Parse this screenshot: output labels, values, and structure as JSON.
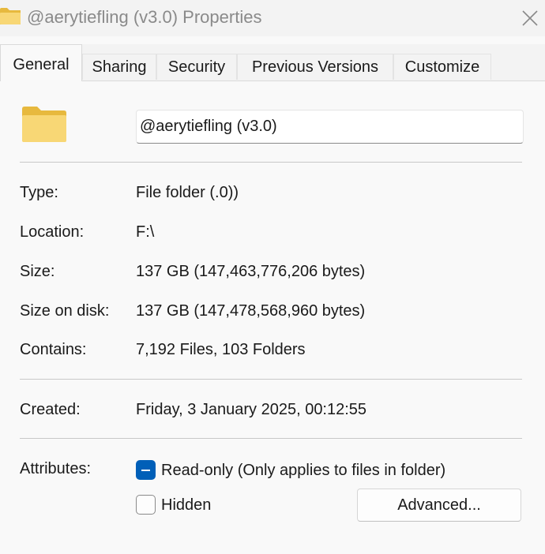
{
  "window": {
    "title": "@aerytiefling (v3.0) Properties",
    "close_icon": "close-icon"
  },
  "tabs": [
    {
      "label": "General",
      "active": true
    },
    {
      "label": "Sharing",
      "active": false
    },
    {
      "label": "Security",
      "active": false
    },
    {
      "label": "Previous Versions",
      "active": false
    },
    {
      "label": "Customize",
      "active": false
    }
  ],
  "general": {
    "folder_icon": "folder-icon",
    "name_value": "@aerytiefling (v3.0)",
    "details": [
      {
        "label": "Type:",
        "value": "File folder (.0))"
      },
      {
        "label": "Location:",
        "value": "F:\\"
      },
      {
        "label": "Size:",
        "value": "137 GB (147,463,776,206 bytes)"
      },
      {
        "label": "Size on disk:",
        "value": "137 GB (147,478,568,960 bytes)"
      },
      {
        "label": "Contains:",
        "value": "7,192 Files, 103 Folders"
      }
    ],
    "created": {
      "label": "Created:",
      "value": "Friday, 3 January 2025, 00:12:55"
    },
    "attributes": {
      "label": "Attributes:",
      "readonly": {
        "label": "Read-only (Only applies to files in folder)",
        "state": "indeterminate"
      },
      "hidden": {
        "label": "Hidden",
        "state": "unchecked"
      },
      "advanced_label": "Advanced..."
    }
  },
  "colors": {
    "accent": "#005fb8",
    "folder_yellow": "#f8d775",
    "folder_tab": "#e7b93e"
  }
}
